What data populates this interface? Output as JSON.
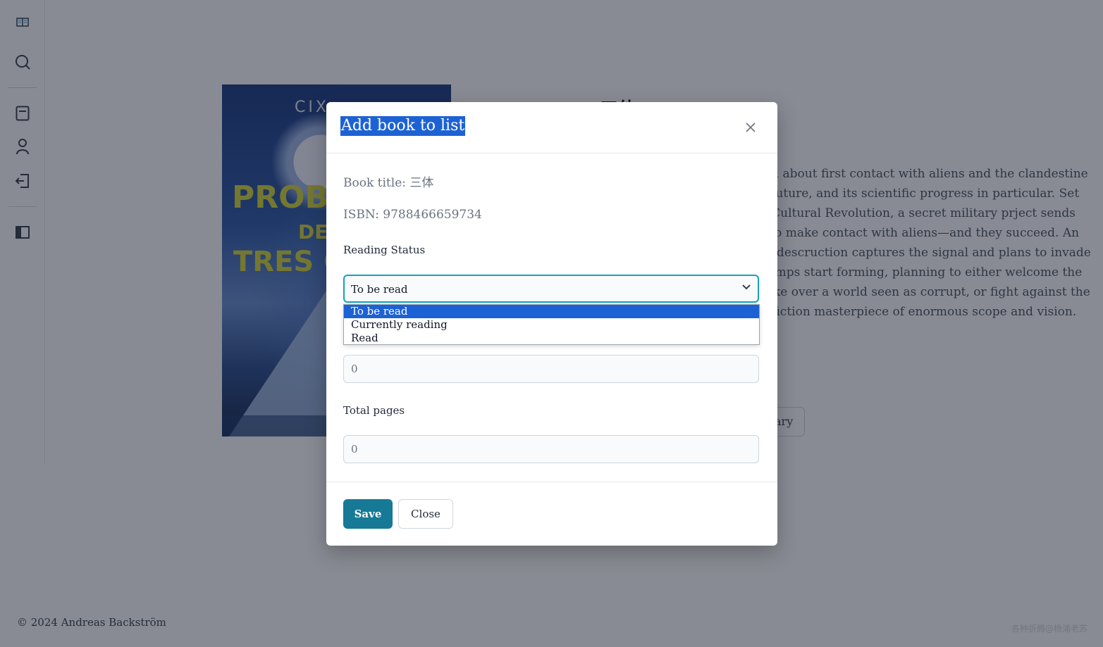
{
  "sidebar": {
    "icons": [
      "open-book-icon",
      "search-icon",
      "list-icon",
      "user-icon",
      "logout-icon",
      "sidebar-toggle-icon"
    ]
  },
  "book": {
    "title": "三体",
    "cover": {
      "author": "CIX",
      "title_line1": "PROB",
      "title_line2": "DE",
      "title_line3": "TRES C"
    },
    "description_lines": [
      "vel about first contact with aliens and the clandestine",
      "s future, and its scientific progress in particular. Set",
      "s Cultural Revolution, a secret military prject sends",
      "t to make contact with aliens—and they succeed. An",
      "of descruction captures the signal and plans to invade",
      "camps start forming, planning to either welcome the",
      "take over a world seen as corrupt, or fight against the",
      "e fiction masterpiece of enormous scope and vision."
    ],
    "library_button_partial": "ary"
  },
  "footer": {
    "copyright": "© 2024 Andreas Backström",
    "watermark": "各种折腾@杨浦老苏"
  },
  "modal": {
    "title": "Add book to list",
    "book_title_line": "Book title: 三体",
    "isbn_line": "ISBN: 9788466659734",
    "reading_status_label": "Reading Status",
    "reading_status_value": "To be read",
    "reading_status_options": [
      "To be read",
      "Currently reading",
      "Read"
    ],
    "pages_read_value": "0",
    "total_pages_label": "Total pages",
    "total_pages_value": "0",
    "save_label": "Save",
    "close_label": "Close"
  },
  "colors": {
    "accent": "#167a96",
    "focus_border": "#14a3b8",
    "selection": "#1d62d4"
  }
}
